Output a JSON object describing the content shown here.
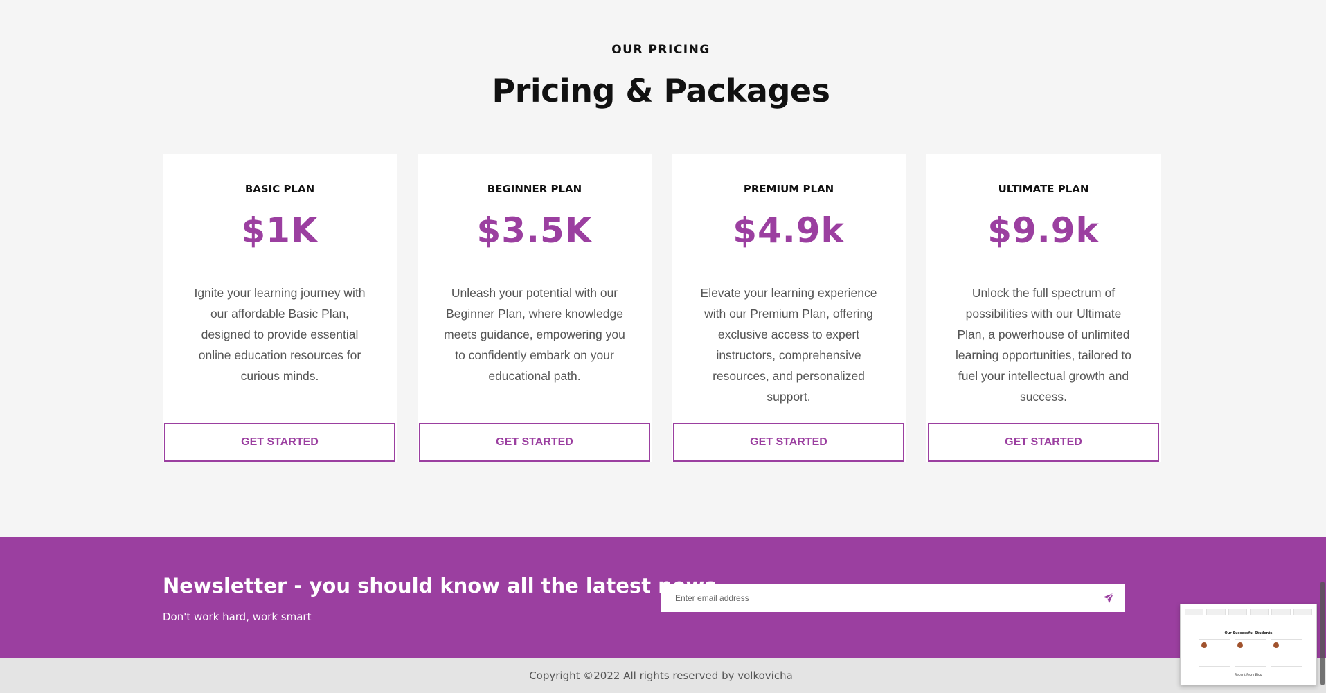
{
  "pricing": {
    "eyebrow": "OUR PRICING",
    "title": "Pricing & Packages",
    "plans": [
      {
        "name": "BASIC PLAN",
        "price": "$1K",
        "description": "Ignite your learning journey with our affordable Basic Plan, designed to provide essential online education resources for curious minds.",
        "cta": "GET STARTED"
      },
      {
        "name": "BEGINNER PLAN",
        "price": "$3.5K",
        "description": "Unleash your potential with our Beginner Plan, where knowledge meets guidance, empowering you to confidently embark on your educational path.",
        "cta": "GET STARTED"
      },
      {
        "name": "PREMIUM PLAN",
        "price": "$4.9k",
        "description": "Elevate your learning experience with our Premium Plan, offering exclusive access to expert instructors, comprehensive resources, and personalized support.",
        "cta": "GET STARTED"
      },
      {
        "name": "ULTIMATE PLAN",
        "price": "$9.9k",
        "description": "Unlock the full spectrum of possibilities with our Ultimate Plan, a powerhouse of unlimited learning opportunities, tailored to fuel your intellectual growth and success.",
        "cta": "GET STARTED"
      }
    ]
  },
  "newsletter": {
    "title": "Newsletter - you should know all the latest news",
    "subtitle": "Don't work hard, work smart",
    "email_placeholder": "Enter email address",
    "send_icon": "paper-plane-icon"
  },
  "footer": {
    "copyright": "Copyright ©2022 All rights reserved by volkovicha"
  },
  "preview": {
    "title": "Our Successful Students",
    "footer": "Recent From Blog"
  },
  "colors": {
    "accent": "#9b3fa0",
    "background": "#f5f5f5",
    "footer_bg": "#e4e4e4"
  }
}
